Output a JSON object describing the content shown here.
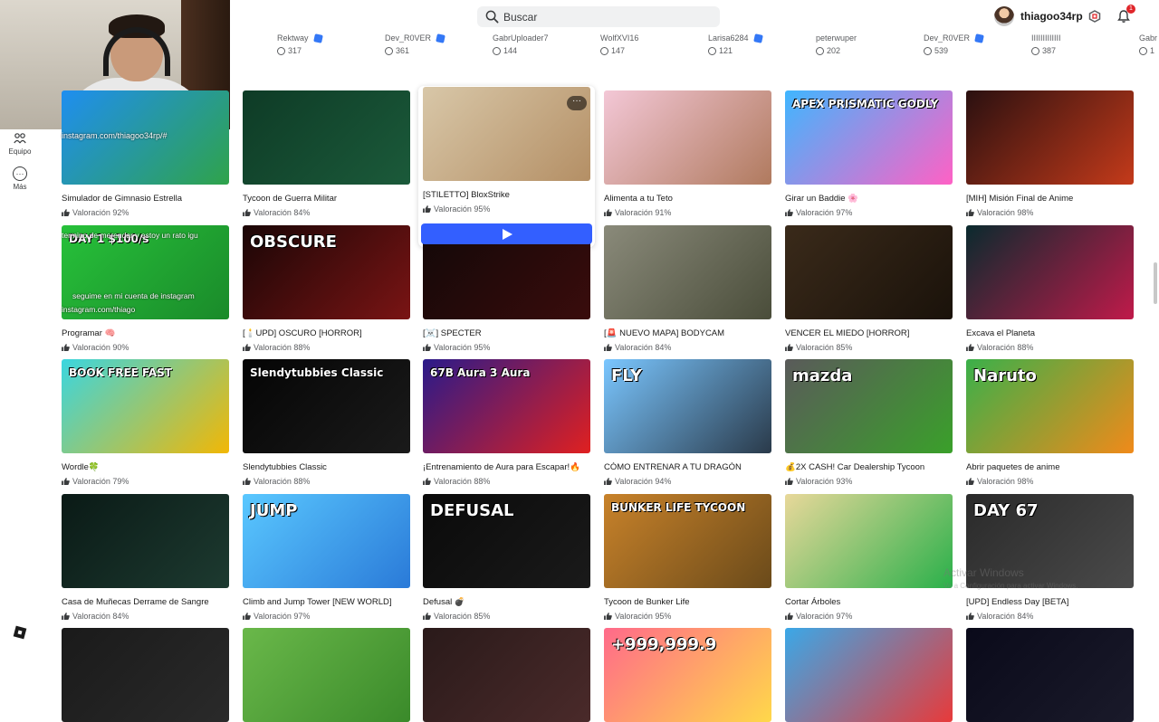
{
  "search": {
    "placeholder": "Buscar"
  },
  "user": {
    "name": "thiagoo34rp",
    "notifications": "1"
  },
  "friends": [
    {
      "name": "Rektway",
      "count": "317",
      "verified": true
    },
    {
      "name": "Dev_R0VER",
      "count": "361",
      "verified": true
    },
    {
      "name": "GabrUploader7",
      "count": "144",
      "verified": false
    },
    {
      "name": "WolfXVI16",
      "count": "147",
      "verified": false
    },
    {
      "name": "Larisa6284",
      "count": "121",
      "verified": true
    },
    {
      "name": "peterwuper",
      "count": "202",
      "verified": false
    },
    {
      "name": "Dev_R0VER",
      "count": "539",
      "verified": true
    },
    {
      "name": "IIIIIIIIIIIII",
      "count": "387",
      "verified": false
    },
    {
      "name": "Gabr",
      "count": "1",
      "verified": false
    }
  ],
  "nav": [
    {
      "label": "Equipo",
      "icon": "team-icon"
    },
    {
      "label": "Más",
      "icon": "more-icon"
    }
  ],
  "games": [
    {
      "title": "Simulador de Gimnasio Estrella",
      "rating": "Valoración 92%",
      "c1": "#1f8ef0",
      "c2": "#2fa34a",
      "label": ""
    },
    {
      "title": "Tycoon de Guerra Militar",
      "rating": "Valoración 84%",
      "c1": "#0e3b26",
      "c2": "#1b5a3a",
      "label": ""
    },
    {
      "title": "[STILETTO] BloxStrike",
      "rating": "Valoración 95%",
      "c1": "#d8c7a8",
      "c2": "#b48f65",
      "label": ""
    },
    {
      "title": "Alimenta a tu Teto",
      "rating": "Valoración 91%",
      "c1": "#f3c7d6",
      "c2": "#b07a5e",
      "label": ""
    },
    {
      "title": "Girar un Baddie 🌸",
      "rating": "Valoración 97%",
      "c1": "#3fb6ff",
      "c2": "#ff61c5",
      "label": "APEX PRISMATIC GODLY"
    },
    {
      "title": "[MIH] Misión Final de Anime",
      "rating": "Valoración 98%",
      "c1": "#2a1010",
      "c2": "#c43a1a",
      "label": ""
    },
    {
      "title": "Programar 🧠",
      "rating": "Valoración 90%",
      "c1": "#27c13a",
      "c2": "#1a8a2a",
      "label": "DAY 1  $100/s"
    },
    {
      "title": "[🕯️UPD] OSCURO [HORROR]",
      "rating": "Valoración 88%",
      "c1": "#1a0606",
      "c2": "#7a1414",
      "label": "OBSCURE"
    },
    {
      "title": "[☠️] SPECTER",
      "rating": "Valoración 95%",
      "c1": "#120808",
      "c2": "#3a0c0c",
      "label": ""
    },
    {
      "title": "[🚨 NUEVO MAPA] BODYCAM",
      "rating": "Valoración 84%",
      "c1": "#8a8a7a",
      "c2": "#4a4d3a",
      "label": ""
    },
    {
      "title": "VENCER EL MIEDO [HORROR]",
      "rating": "Valoración 85%",
      "c1": "#3a2a1a",
      "c2": "#1a120a",
      "label": ""
    },
    {
      "title": "Excava el Planeta",
      "rating": "Valoración 88%",
      "c1": "#0a2a2e",
      "c2": "#c01a4a",
      "label": ""
    },
    {
      "title": "Wordle🍀",
      "rating": "Valoración 79%",
      "c1": "#3ad6e0",
      "c2": "#f2b705",
      "label": "BOOK FREE FAST"
    },
    {
      "title": "Slendytubbies Classic",
      "rating": "Valoración 88%",
      "c1": "#050505",
      "c2": "#1a1a1a",
      "label": "Slendytubbies Classic"
    },
    {
      "title": "¡Entrenamiento de Aura para Escapar!🔥",
      "rating": "Valoración 88%",
      "c1": "#2a1a8a",
      "c2": "#e02020",
      "label": "67B Aura   3 Aura"
    },
    {
      "title": "CÓMO ENTRENAR A TU DRAGÓN",
      "rating": "Valoración 94%",
      "c1": "#7ac6ff",
      "c2": "#2a3a4a",
      "label": "FLY"
    },
    {
      "title": "💰2X CASH! Car Dealership Tycoon",
      "rating": "Valoración 93%",
      "c1": "#5a5a5a",
      "c2": "#3aa02a",
      "label": "mazda"
    },
    {
      "title": "Abrir paquetes de anime",
      "rating": "Valoración 98%",
      "c1": "#3ab04a",
      "c2": "#f08a1a",
      "label": "Naruto"
    },
    {
      "title": "Casa de Muñecas Derrame de Sangre",
      "rating": "Valoración 84%",
      "c1": "#0a1a16",
      "c2": "#1d3a30",
      "label": ""
    },
    {
      "title": "Climb and Jump Tower [NEW WORLD]",
      "rating": "Valoración 97%",
      "c1": "#5ac8ff",
      "c2": "#2a7ad8",
      "label": "JUMP"
    },
    {
      "title": "Defusal 💣",
      "rating": "Valoración 85%",
      "c1": "#0a0a0a",
      "c2": "#1a1a1a",
      "label": "DEFUSAL"
    },
    {
      "title": "Tycoon de Bunker Life",
      "rating": "Valoración 95%",
      "c1": "#c8822a",
      "c2": "#6a4a1a",
      "label": "BUNKER LIFE TYCOON"
    },
    {
      "title": "Cortar Árboles",
      "rating": "Valoración 97%",
      "c1": "#e8d89a",
      "c2": "#2ab04a",
      "label": ""
    },
    {
      "title": "[UPD] Endless Day [BETA]",
      "rating": "Valoración 84%",
      "c1": "#2a2a2a",
      "c2": "#4a4a4a",
      "label": "DAY 67"
    },
    {
      "title": "",
      "rating": "",
      "c1": "#1a1a1a",
      "c2": "#2a2a2a",
      "label": ""
    },
    {
      "title": "",
      "rating": "",
      "c1": "#6ab84a",
      "c2": "#3a8a2a",
      "label": ""
    },
    {
      "title": "",
      "rating": "",
      "c1": "#2a1a1a",
      "c2": "#4a2a2a",
      "label": ""
    },
    {
      "title": "",
      "rating": "",
      "c1": "#ff6a8a",
      "c2": "#ffd84a",
      "label": "+999,999.9"
    },
    {
      "title": "",
      "rating": "",
      "c1": "#3aa8e8",
      "c2": "#e83a3a",
      "label": ""
    },
    {
      "title": "",
      "rating": "",
      "c1": "#0a0a1a",
      "c2": "#1a1a2a",
      "label": ""
    }
  ],
  "overlay": {
    "webcam_text1": "instagram.com/thiagoo34rp/#",
    "webcam_text2": "termino de merendar y estoy un rato igu",
    "webcam_text3": "seguime en mi cuenta de instagram",
    "webcam_text4": "instagram.com/thiago"
  },
  "watermark": {
    "line1": "Activar Windows",
    "line2": "Ve a Configuración para activar Windows."
  },
  "colors": {
    "accent": "#335fff",
    "verified": "#3478f6",
    "notification": "#e0262a"
  }
}
